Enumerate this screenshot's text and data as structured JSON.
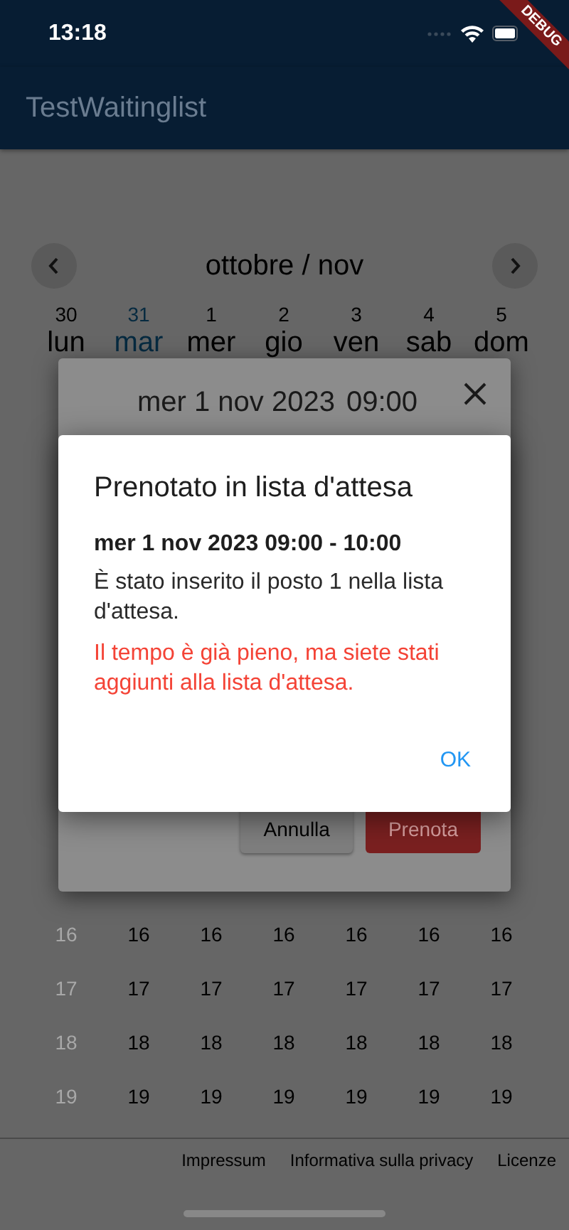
{
  "status_bar": {
    "time": "13:18"
  },
  "debug_banner": "DEBUG",
  "app_bar": {
    "title": "TestWaitinglist"
  },
  "calendar": {
    "month": "ottobre / nov",
    "days": [
      {
        "date": "30",
        "weekday": "lun",
        "today": false
      },
      {
        "date": "31",
        "weekday": "mar",
        "today": true
      },
      {
        "date": "1",
        "weekday": "mer",
        "today": false
      },
      {
        "date": "2",
        "weekday": "gio",
        "today": false
      },
      {
        "date": "3",
        "weekday": "ven",
        "today": false
      },
      {
        "date": "4",
        "weekday": "sab",
        "today": false
      },
      {
        "date": "5",
        "weekday": "dom",
        "today": false
      }
    ],
    "slot_rows": [
      {
        "cells": [
          {
            "text": "16",
            "disabled": true
          },
          {
            "text": "16",
            "disabled": false
          },
          {
            "text": "16",
            "disabled": false
          },
          {
            "text": "16",
            "disabled": false
          },
          {
            "text": "16",
            "disabled": false
          },
          {
            "text": "16",
            "disabled": false
          },
          {
            "text": "16",
            "disabled": false
          }
        ]
      },
      {
        "cells": [
          {
            "text": "17",
            "disabled": true
          },
          {
            "text": "17",
            "disabled": false
          },
          {
            "text": "17",
            "disabled": false
          },
          {
            "text": "17",
            "disabled": false
          },
          {
            "text": "17",
            "disabled": false
          },
          {
            "text": "17",
            "disabled": false
          },
          {
            "text": "17",
            "disabled": false
          }
        ]
      },
      {
        "cells": [
          {
            "text": "18",
            "disabled": true
          },
          {
            "text": "18",
            "disabled": false
          },
          {
            "text": "18",
            "disabled": false
          },
          {
            "text": "18",
            "disabled": false
          },
          {
            "text": "18",
            "disabled": false
          },
          {
            "text": "18",
            "disabled": false
          },
          {
            "text": "18",
            "disabled": false
          }
        ]
      },
      {
        "cells": [
          {
            "text": "19",
            "disabled": true
          },
          {
            "text": "19",
            "disabled": false
          },
          {
            "text": "19",
            "disabled": false
          },
          {
            "text": "19",
            "disabled": false
          },
          {
            "text": "19",
            "disabled": false
          },
          {
            "text": "19",
            "disabled": false
          },
          {
            "text": "19",
            "disabled": false
          }
        ]
      }
    ]
  },
  "booking_sheet": {
    "date": "mer 1 nov 2023",
    "time": "09:00",
    "buttons": [
      {
        "label": "Annulla",
        "kind": "secondary"
      },
      {
        "label": "Prenota",
        "kind": "primary"
      }
    ]
  },
  "alert": {
    "title": "Prenotato in lista d'attesa",
    "slot": "mer 1 nov 2023 09:00 - 10:00",
    "message": "È stato inserito il posto 1 nella lista d'attesa.",
    "warning": "Il tempo è già pieno, ma siete stati aggiunti alla lista d'attesa.",
    "action": "OK"
  },
  "footer": {
    "links": [
      "Impressum",
      "Informativa sulla privacy",
      "Licenze"
    ]
  }
}
